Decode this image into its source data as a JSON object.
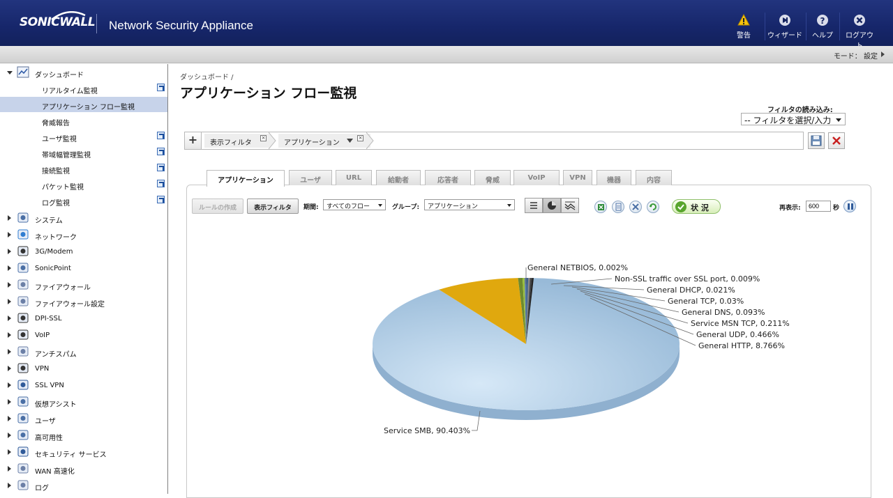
{
  "header": {
    "brand": "SONICWALL",
    "product": "Network Security Appliance",
    "buttons": [
      {
        "label": "警告",
        "icon": "warning-icon"
      },
      {
        "label": "ウィザード",
        "icon": "wizard-icon"
      },
      {
        "label": "ヘルプ",
        "icon": "help-icon"
      },
      {
        "label": "ログアウト",
        "icon": "logout-icon"
      }
    ]
  },
  "modebar": {
    "text": "モード： 設定"
  },
  "sidebar": {
    "dashboard": {
      "label": "ダッシュボード",
      "items": [
        {
          "label": "リアルタイム監視",
          "popout": true
        },
        {
          "label": "アプリケーション フロー監視",
          "popout": false,
          "active": true
        },
        {
          "label": "脅威報告",
          "popout": false
        },
        {
          "label": "ユーザ監視",
          "popout": true
        },
        {
          "label": "帯域幅管理監視",
          "popout": true
        },
        {
          "label": "接続監視",
          "popout": true
        },
        {
          "label": "パケット監視",
          "popout": true
        },
        {
          "label": "ログ監視",
          "popout": true
        }
      ]
    },
    "groups": [
      {
        "label": "システム",
        "icon": "monitor-icon"
      },
      {
        "label": "ネットワーク",
        "icon": "network-globe-icon"
      },
      {
        "label": "3G/Modem",
        "icon": "modem-icon"
      },
      {
        "label": "SonicPoint",
        "icon": "access-point-icon"
      },
      {
        "label": "ファイアウォール",
        "icon": "firewall-icon"
      },
      {
        "label": "ファイアウォール設定",
        "icon": "firewall-settings-icon"
      },
      {
        "label": "DPI-SSL",
        "icon": "dpi-ssl-lock-icon"
      },
      {
        "label": "VoIP",
        "icon": "headset-icon"
      },
      {
        "label": "アンチスパム",
        "icon": "antispam-mail-icon"
      },
      {
        "label": "VPN",
        "icon": "vpn-lock-icon"
      },
      {
        "label": "SSL VPN",
        "icon": "ssl-vpn-icon"
      },
      {
        "label": "仮想アシスト",
        "icon": "virtual-assist-icon"
      },
      {
        "label": "ユーザ",
        "icon": "users-icon"
      },
      {
        "label": "高可用性",
        "icon": "high-availability-icon"
      },
      {
        "label": "セキュリティ サービス",
        "icon": "shield-icon"
      },
      {
        "label": "WAN 高速化",
        "icon": "wan-accel-icon"
      },
      {
        "label": "ログ",
        "icon": "log-icon"
      }
    ]
  },
  "main": {
    "breadcrumb": "ダッシュボード /",
    "title": "アプリケーション フロー監視",
    "filter_load": {
      "label": "フィルタの読み込み:",
      "value": "-- フィルタを選択/入力"
    },
    "filterbar": {
      "add": "+",
      "chip1": "表示フィルタ",
      "chip2": "アプリケーション",
      "chip_close": "×"
    },
    "tabs": [
      "アプリケーション",
      "ユーザ",
      "URL",
      "給動者",
      "応答者",
      "脅威",
      "VoIP",
      "VPN",
      "機器",
      "内容"
    ],
    "toolbar": {
      "create_rule": "ルールの作成",
      "view_filter": "表示フィルタ",
      "period_label": "期間:",
      "period_value": "すべてのフロー",
      "group_label": "グループ:",
      "group_value": "アプリケーション",
      "status": "状 況",
      "refresh_label": "再表示:",
      "refresh_value": "600",
      "refresh_unit": "秒"
    }
  },
  "chart_data": {
    "type": "pie",
    "title": "",
    "slices": [
      {
        "label": "Service SMB, 90.403%",
        "value": 90.403,
        "color": "#a9c8e2"
      },
      {
        "label": "General HTTP, 8.766%",
        "value": 8.766,
        "color": "#e0a80e"
      },
      {
        "label": "General UDP, 0.466%",
        "value": 0.466,
        "color": "#6e8a2e"
      },
      {
        "label": "Service MSN TCP, 0.211%",
        "value": 0.211,
        "color": "#9bbf3c"
      },
      {
        "label": "General DNS, 0.093%",
        "value": 0.093,
        "color": "#5c7ea8"
      },
      {
        "label": "General TCP, 0.03%",
        "value": 0.03,
        "color": "#3c5f8c"
      },
      {
        "label": "General DHCP, 0.021%",
        "value": 0.021,
        "color": "#888"
      },
      {
        "label": "Non-SSL traffic over SSL port, 0.009%",
        "value": 0.009,
        "color": "#444"
      },
      {
        "label": "General NETBIOS, 0.002%",
        "value": 0.002,
        "color": "#222"
      }
    ]
  }
}
